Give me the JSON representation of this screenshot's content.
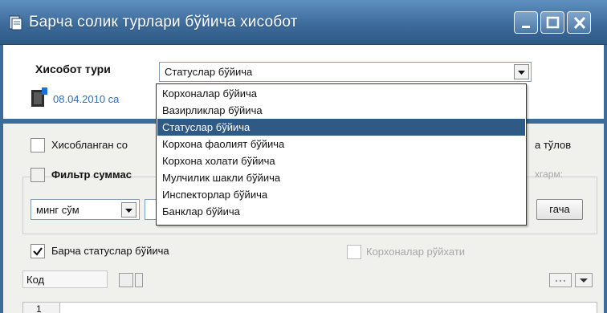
{
  "window": {
    "title": "Барча солик турлари бўйича хисобот",
    "buttons": {
      "minimize": "minimize",
      "maximize": "maximize",
      "close": "close"
    }
  },
  "report": {
    "type_label": "Хисобот тури",
    "selected_type": "Статуслар бўйича",
    "date_text": "08.04.2010 са",
    "options": [
      {
        "label": "Корхоналар бўйича",
        "selected": false
      },
      {
        "label": "Вазирликлар бўйича",
        "selected": false
      },
      {
        "label": "Статуслар бўйича",
        "selected": true
      },
      {
        "label": "Корхона фаолият бўйича",
        "selected": false
      },
      {
        "label": "Корхона холати бўйича",
        "selected": false
      },
      {
        "label": "Мулчилик шакли бўйича",
        "selected": false
      },
      {
        "label": "Инспекторлар бўйича",
        "selected": false
      },
      {
        "label": "Банклар бўйича",
        "selected": false
      }
    ]
  },
  "filters": {
    "hisoblangan_label": "Хисобланган со",
    "hisoblangan_tail": "а тўлов",
    "filter_sum_label": "Фильтр суммас",
    "faded_tail": "хгарм:",
    "unit_value": "минг сўм",
    "apply_button": "гача",
    "all_status_label": "Барча статуслар бўйича",
    "all_status_checked": true,
    "companies_list_label": "Корхоналар рўйхати"
  },
  "grid": {
    "code_header": "Код",
    "first_row_number": "1"
  },
  "colors": {
    "titlebar": "#3d6b9a",
    "selection": "#2f5a86",
    "link": "#2a6fb8"
  }
}
